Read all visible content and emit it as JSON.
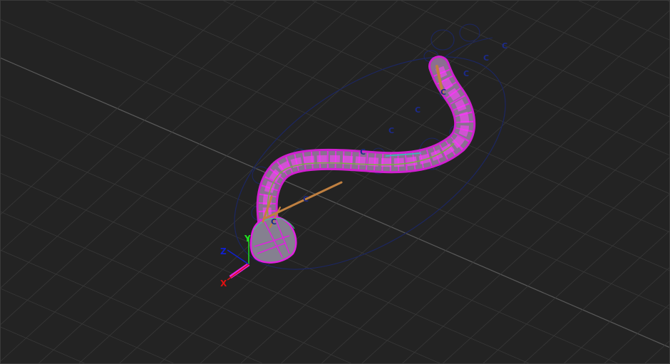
{
  "viewport": {
    "name": "3D perspective viewport",
    "colors": {
      "background": "#232323",
      "grid": "#3a3a3a",
      "grid_axis": "#5a5a5a",
      "mesh": "#e020e0",
      "controls": "#1c2a6a",
      "bones": "#c08040"
    }
  },
  "gizmo": {
    "x_label": "X",
    "y_label": "Y",
    "z_label": "Z",
    "colors": {
      "x": "#e01010",
      "y": "#20e020",
      "z": "#1020d0"
    }
  },
  "controls": {
    "labels": [
      "C",
      "C",
      "C",
      "C",
      "C",
      "C",
      "C",
      "C",
      "C"
    ]
  }
}
